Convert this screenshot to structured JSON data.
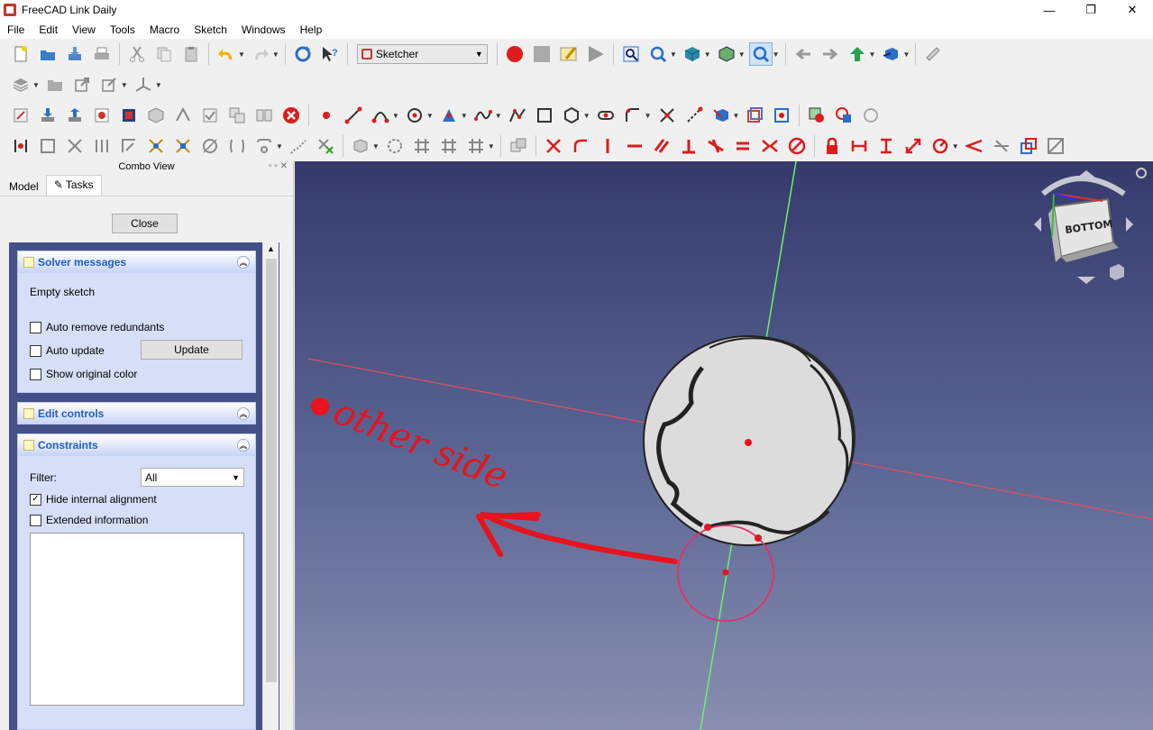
{
  "window": {
    "title": "FreeCAD Link Daily",
    "minimize": "—",
    "maximize": "❐",
    "close": "✕"
  },
  "menu": [
    "File",
    "Edit",
    "View",
    "Tools",
    "Macro",
    "Sketch",
    "Windows",
    "Help"
  ],
  "toolbar": {
    "workbench": "Sketcher"
  },
  "combo": {
    "title": "Combo View",
    "tabs": [
      "Model",
      "Tasks"
    ],
    "active_tab": "Tasks",
    "close_label": "Close"
  },
  "solver": {
    "title": "Solver messages",
    "message": "Empty sketch",
    "auto_remove": "Auto remove redundants",
    "auto_update": "Auto update",
    "update_button": "Update",
    "show_original": "Show original color"
  },
  "edit_controls": {
    "title": "Edit controls"
  },
  "constraints": {
    "title": "Constraints",
    "filter_label": "Filter:",
    "filter_value": "All",
    "hide_internal": "Hide internal alignment",
    "hide_internal_checked": true,
    "extended": "Extended information"
  },
  "viewport": {
    "navcube_label": "BOTTOM",
    "annotation": "other side",
    "colors": {
      "x_axis": "#e0505a",
      "y_axis": "#6cf06c",
      "annotation": "#e8131c",
      "circle": "#e0306a"
    }
  }
}
